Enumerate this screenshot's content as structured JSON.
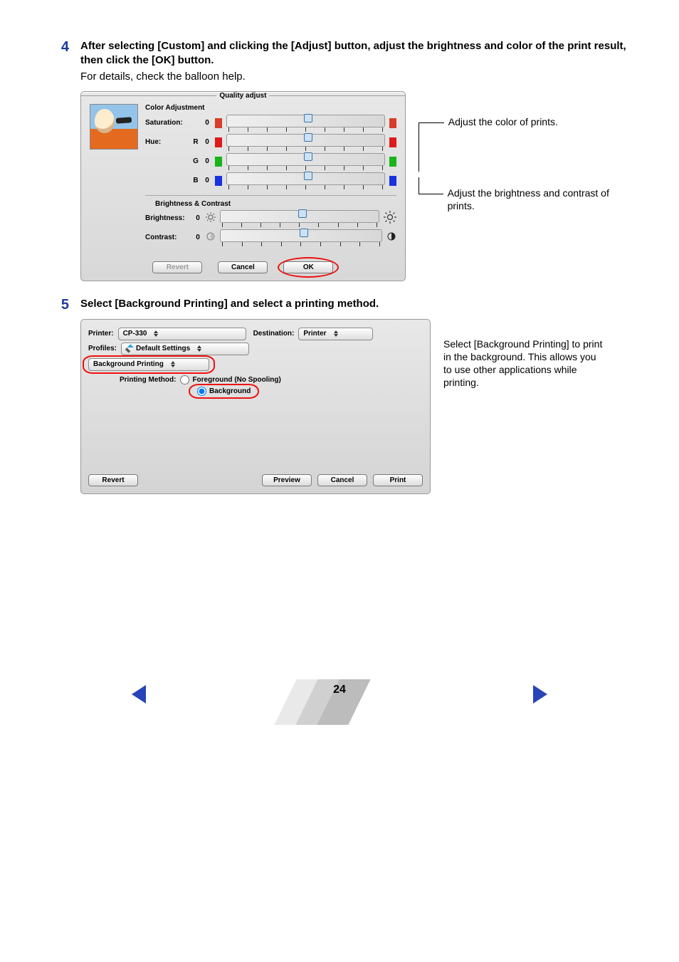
{
  "step4": {
    "num": "4",
    "instruction": "After selecting [Custom] and clicking the [Adjust] button, adjust the brightness and color of the print result, then click the [OK] button.",
    "sub": "For details, check the balloon help."
  },
  "quality_adjust": {
    "title": "Quality adjust",
    "color_adj_header": "Color Adjustment",
    "saturation": {
      "label": "Saturation:",
      "value": "0"
    },
    "hue": {
      "label": "Hue:",
      "r_label": "R",
      "g_label": "G",
      "b_label": "B",
      "r": "0",
      "g": "0",
      "b": "0"
    },
    "bc_header": "Brightness & Contrast",
    "brightness": {
      "label": "Brightness:",
      "value": "0"
    },
    "contrast": {
      "label": "Contrast:",
      "value": "0"
    },
    "buttons": {
      "revert": "Revert",
      "cancel": "Cancel",
      "ok": "OK"
    }
  },
  "annotations": {
    "color": "Adjust the color of prints.",
    "bc": "Adjust the brightness and contrast of prints.",
    "bg": "Select [Background Printing] to print in the background. This allows you to use other applications while printing."
  },
  "step5": {
    "num": "5",
    "instruction": "Select [Background Printing] and select a printing method."
  },
  "print_dialog": {
    "printer_label": "Printer:",
    "printer_value": "CP-330",
    "dest_label": "Destination:",
    "dest_value": "Printer",
    "profiles_label": "Profiles:",
    "profiles_value": "Default Settings",
    "panel": "Background Printing",
    "pm_label": "Printing Method:",
    "radio_fg": "Foreground (No Spooling)",
    "radio_bg": "Background",
    "buttons": {
      "revert": "Revert",
      "preview": "Preview",
      "cancel": "Cancel",
      "print": "Print"
    }
  },
  "footer": {
    "page": "24"
  }
}
